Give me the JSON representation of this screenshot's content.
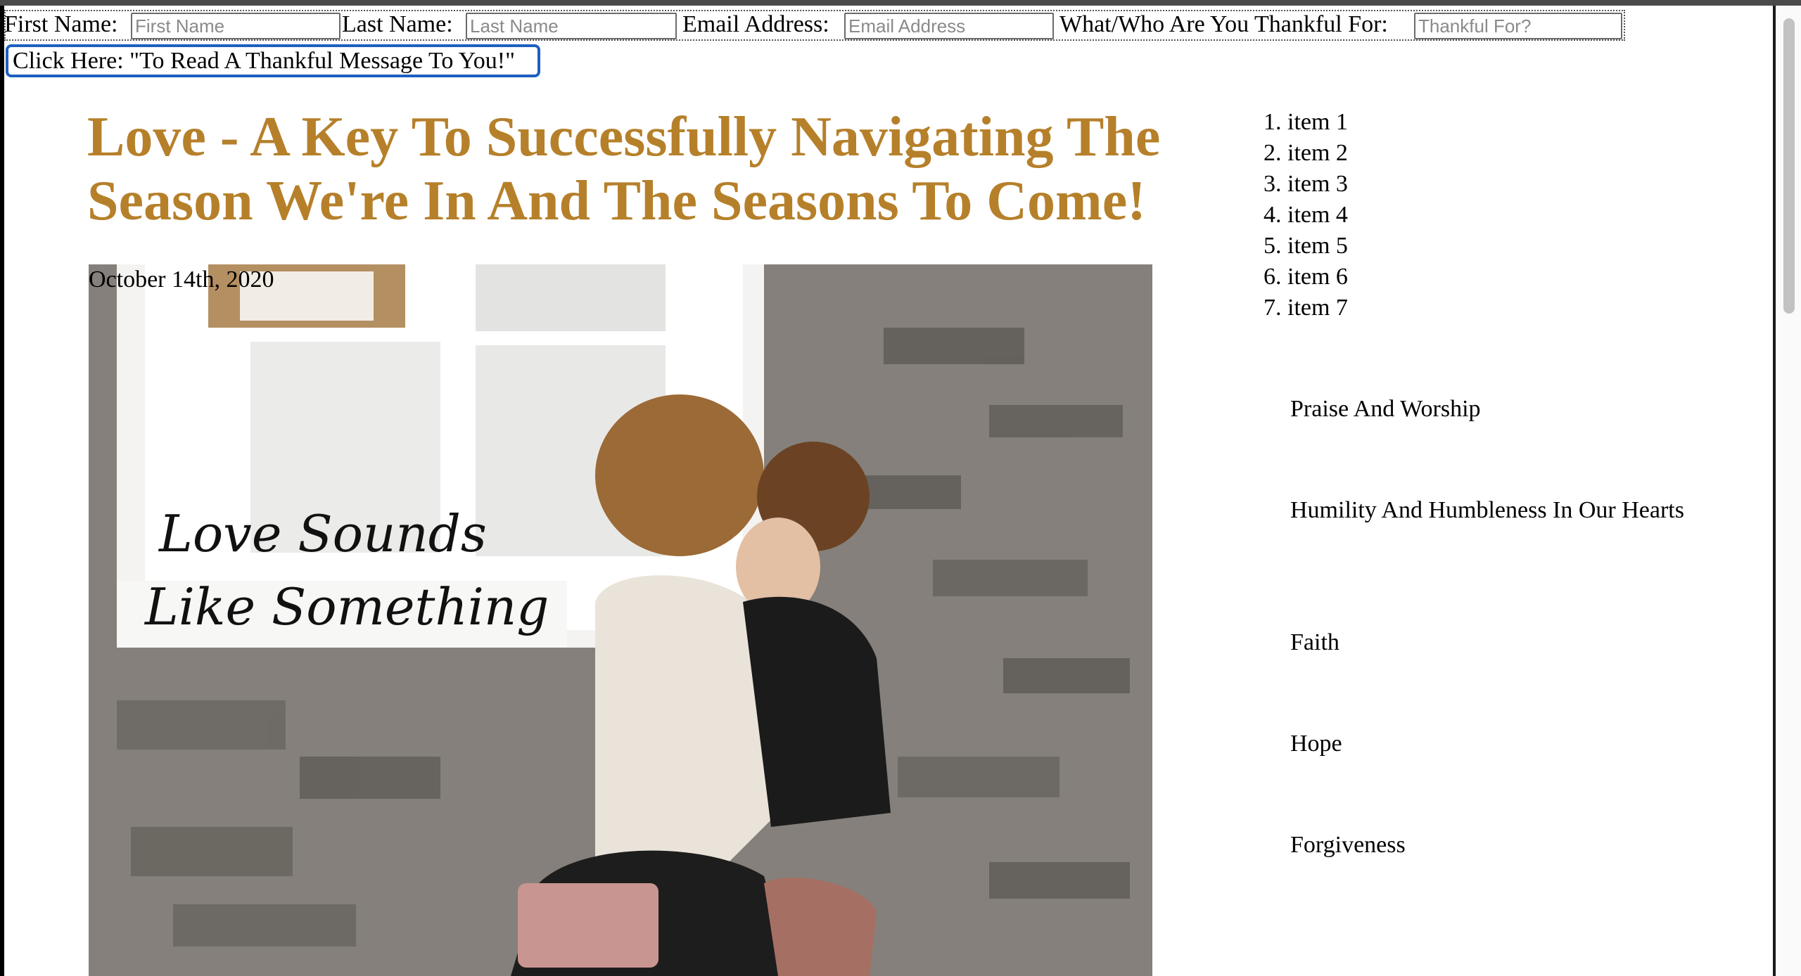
{
  "form": {
    "first_name_label": "First Name:",
    "first_name_placeholder": "First Name",
    "last_name_label": "Last Name:",
    "last_name_placeholder": "Last Name",
    "email_label": "Email Address:",
    "email_placeholder": "Email Address",
    "thankful_label": "What/Who Are You Thankful For:",
    "thankful_placeholder": "Thankful For?",
    "submit_label": "Click Here: \"To Read A Thankful Message To You!\""
  },
  "article": {
    "title": "Love - A Key To Successfully Navigating The Season We're In And The Seasons To Come!",
    "date": "October 14th, 2020",
    "image": {
      "overlay_text_line1": "Love Sounds",
      "overlay_text_line2": "Like Something"
    }
  },
  "sidebar": {
    "numbered_items": [
      "item 1",
      "item 2",
      "item 3",
      "item 4",
      "item 5",
      "item 6",
      "item 7"
    ],
    "links": [
      "Praise And Worship",
      "Humility And Humbleness In Our Hearts",
      "Faith",
      "Hope",
      "Forgiveness"
    ]
  },
  "colors": {
    "title": "#b6802a",
    "button_border": "#1f5fbf"
  }
}
